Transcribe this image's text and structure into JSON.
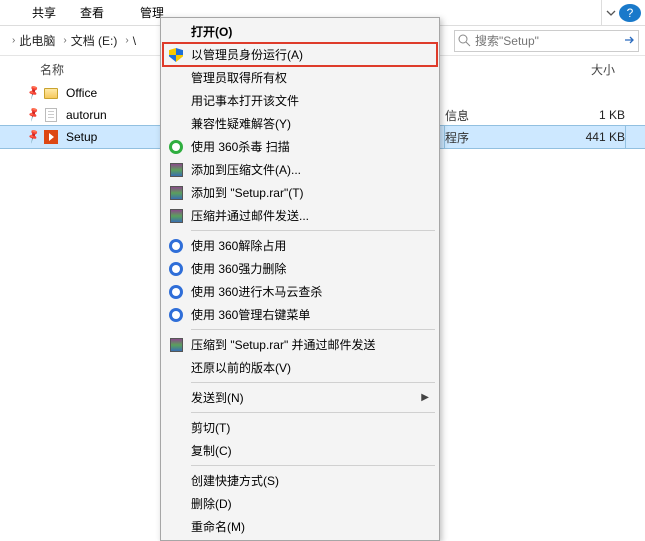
{
  "ribbon": {
    "share": "共享",
    "view": "查看",
    "manage": "管理"
  },
  "breadcrumb": {
    "pc": "此电脑",
    "docs": "文档 (E:)",
    "last": "\\"
  },
  "search": {
    "placeholder": "搜索\"Setup\""
  },
  "help": "?",
  "columns": {
    "name": "名称",
    "size": "大小"
  },
  "files": {
    "office": "Office",
    "autorun": "autorun",
    "setup": "Setup",
    "autorun_type_tail": "信息",
    "autorun_size": "1 KB",
    "setup_type_tail": "程序",
    "setup_size": "441 KB"
  },
  "menu": {
    "open": "打开(O)",
    "run_admin": "以管理员身份运行(A)",
    "admin_own": "管理员取得所有权",
    "notepad": "用记事本打开该文件",
    "compat": "兼容性疑难解答(Y)",
    "scan360": "使用 360杀毒 扫描",
    "addzip": "添加到压缩文件(A)...",
    "addrar": "添加到 \"Setup.rar\"(T)",
    "zipmail": "压缩并通过邮件发送...",
    "rel360": "使用 360解除占用",
    "del360": "使用 360强力删除",
    "trojan360": "使用 360进行木马云查杀",
    "rmenu360": "使用 360管理右键菜单",
    "rarmail": "压缩到 \"Setup.rar\" 并通过邮件发送",
    "restore": "还原以前的版本(V)",
    "sendto": "发送到(N)",
    "cut": "剪切(T)",
    "copy": "复制(C)",
    "shortcut": "创建快捷方式(S)",
    "delete": "删除(D)",
    "rename": "重命名(M)"
  }
}
